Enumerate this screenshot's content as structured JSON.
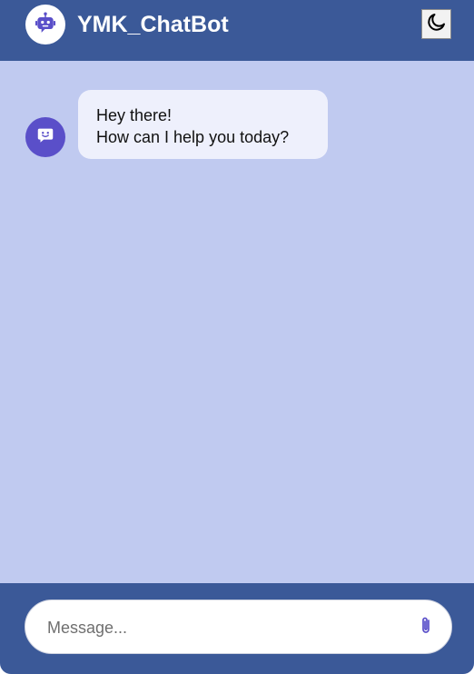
{
  "header": {
    "title": "YMK_ChatBot",
    "avatar_icon": "robot-icon",
    "theme_toggle_icon": "moon-icon"
  },
  "chat": {
    "messages": [
      {
        "sender": "bot",
        "avatar_icon": "chat-smile-icon",
        "lines": [
          "Hey there!",
          "How can I help you today?"
        ]
      }
    ]
  },
  "composer": {
    "placeholder": "Message...",
    "value": "",
    "attach_icon": "paperclip-icon"
  },
  "colors": {
    "header_bg": "#3b5998",
    "chat_bg": "#c0caf0",
    "bot_accent": "#5a4fc9",
    "bubble_bg": "#eef0fc"
  }
}
